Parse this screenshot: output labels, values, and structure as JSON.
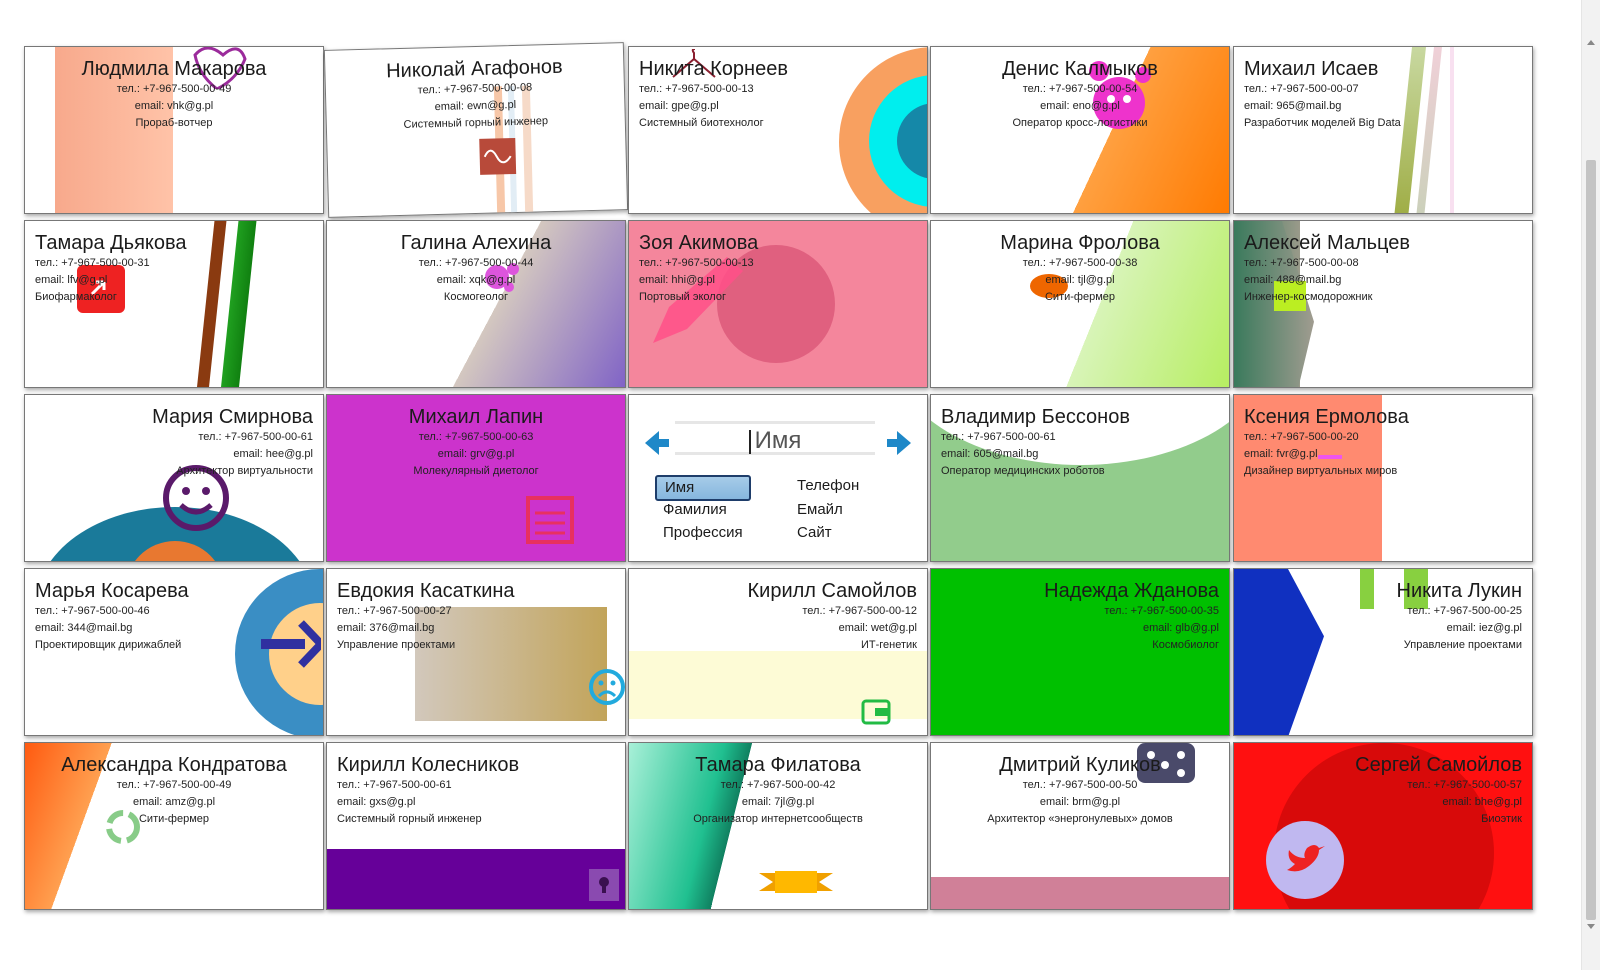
{
  "cards": [
    {
      "name": "Людмила Макарова",
      "phone": "тел.: +7-967-500-00-49",
      "email": "email: vhk@g.pl",
      "role": "Прораб-вотчер"
    },
    {
      "name": "Николай Агафонов",
      "phone": "тел.: +7-967-500-00-08",
      "email": "email: ewn@g.pl",
      "role": "Системный горный инженер"
    },
    {
      "name": "Никита Корнеев",
      "phone": "тел.: +7-967-500-00-13",
      "email": "email: gpe@g.pl",
      "role": "Системный биотехнолог"
    },
    {
      "name": "Денис Калмыков",
      "phone": "тел.: +7-967-500-00-54",
      "email": "email: eno@g.pl",
      "role": "Оператор кросс-логистики"
    },
    {
      "name": "Михаил Исаев",
      "phone": "тел.: +7-967-500-00-07",
      "email": "email: 965@mail.bg",
      "role": "Разработчик моделей Big Data"
    },
    {
      "name": "Тамара Дьякова",
      "phone": "тел.: +7-967-500-00-31",
      "email": "email: lfv@g.pl",
      "role": "Биофармаколог"
    },
    {
      "name": "Галина Алехина",
      "phone": "тел.: +7-967-500-00-44",
      "email": "email: xqk@g.pl",
      "role": "Космогеолог"
    },
    {
      "name": "Зоя Акимова",
      "phone": "тел.: +7-967-500-00-13",
      "email": "email: hhi@g.pl",
      "role": "Портовый эколог"
    },
    {
      "name": "Марина Фролова",
      "phone": "тел.: +7-967-500-00-38",
      "email": "email: tjl@g.pl",
      "role": "Сити-фермер"
    },
    {
      "name": "Алексей Мальцев",
      "phone": "тел.: +7-967-500-00-08",
      "email": "email: 488@mail.bg",
      "role": "Инженер-космодорожник"
    },
    {
      "name": "Мария Смирнова",
      "phone": "тел.: +7-967-500-00-61",
      "email": "email: hee@g.pl",
      "role": "Архитектор виртуальности"
    },
    {
      "name": "Михаил Лапин",
      "phone": "тел.: +7-967-500-00-63",
      "email": "email: grv@g.pl",
      "role": "Молекулярный диетолог"
    },
    {
      "name": "Владимир Бессонов",
      "phone": "тел.: +7-967-500-00-61",
      "email": "email: 605@mail.bg",
      "role": "Оператор медицинских роботов"
    },
    {
      "name": "Ксения Ермолова",
      "phone": "тел.: +7-967-500-00-20",
      "email": "email: fvr@g.pl",
      "role": "Дизайнер виртуальных миров"
    },
    {
      "name": "Марья Косарева",
      "phone": "тел.: +7-967-500-00-46",
      "email": "email: 344@mail.bg",
      "role": "Проектировщик дирижаблей"
    },
    {
      "name": "Евдокия Касаткина",
      "phone": "тел.: +7-967-500-00-27",
      "email": "email: 376@mail.bg",
      "role": "Управление проектами"
    },
    {
      "name": "Кирилл Самойлов",
      "phone": "тел.: +7-967-500-00-12",
      "email": "email: wet@g.pl",
      "role": "ИТ-генетик"
    },
    {
      "name": "Надежда Жданова",
      "phone": "тел.: +7-967-500-00-35",
      "email": "email: glb@g.pl",
      "role": "Космобиолог"
    },
    {
      "name": "Никита Лукин",
      "phone": "тел.: +7-967-500-00-25",
      "email": "email: iez@g.pl",
      "role": "Управление проектами"
    },
    {
      "name": "Александра Кондратова",
      "phone": "тел.: +7-967-500-00-49",
      "email": "email: amz@g.pl",
      "role": "Сити-фермер"
    },
    {
      "name": "Кирилл Колесников",
      "phone": "тел.: +7-967-500-00-61",
      "email": "email: gxs@g.pl",
      "role": "Системный горный инженер"
    },
    {
      "name": "Тамара Филатова",
      "phone": "тел.: +7-967-500-00-42",
      "email": "email: 7jl@g.pl",
      "role": "Организатор интернетсообществ"
    },
    {
      "name": "Дмитрий Куликов",
      "phone": "тел.: +7-967-500-00-50",
      "email": "email: brm@g.pl",
      "role": "Архитектор «энергонулевых» домов"
    },
    {
      "name": "Сергей Самойлов",
      "phone": "тел.: +7-967-500-00-57",
      "email": "email: bhe@g.pl",
      "role": "Биоэтик"
    }
  ],
  "editor": {
    "field_value": "Имя",
    "options": [
      "Имя",
      "Телефон",
      "Фамилия",
      "Емайл",
      "Профессия",
      "Сайт"
    ],
    "selected": "Имя"
  },
  "colors": {
    "accent": "#1e88c8",
    "pink": "#f4869c",
    "magenta": "#cc33cc",
    "green": "#00c000",
    "red": "#ff1010",
    "purple": "#660099"
  }
}
